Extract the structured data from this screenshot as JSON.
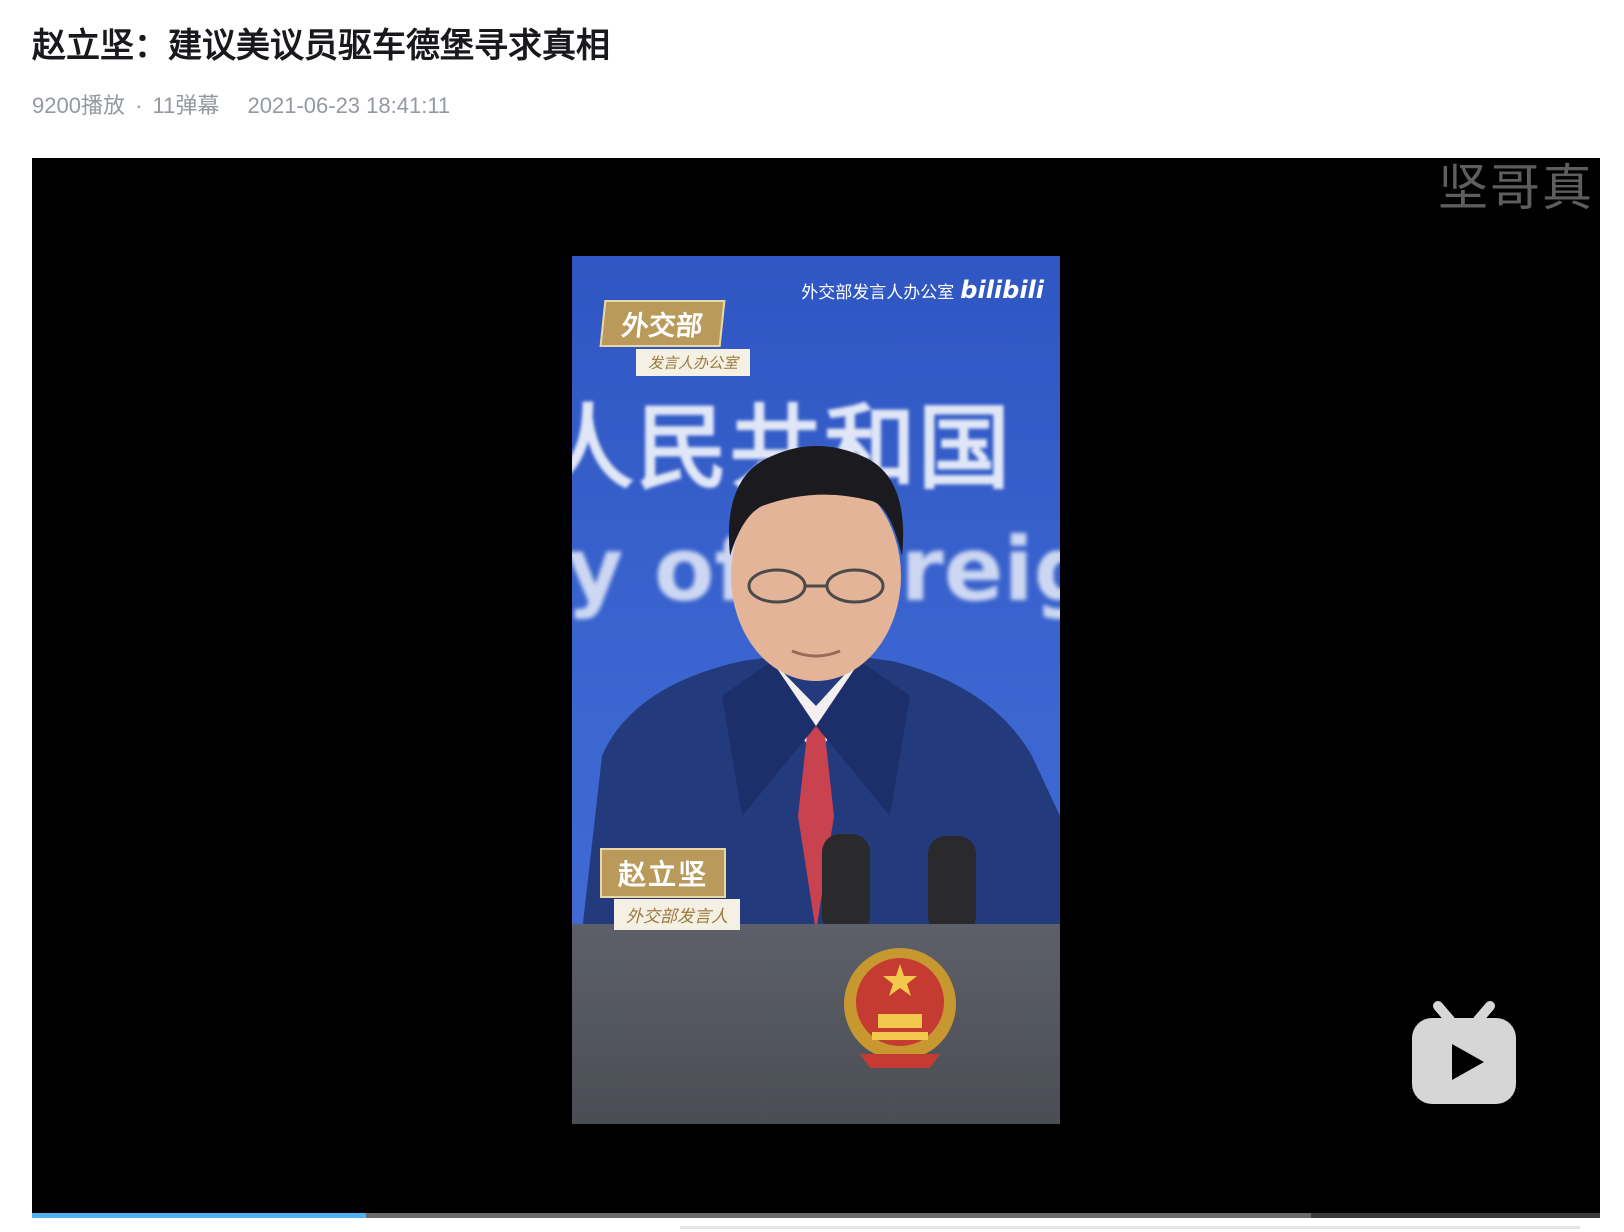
{
  "video": {
    "title": "赵立坚：建议美议员驱车德堡寻求真相",
    "views": "9200播放",
    "separator": "·",
    "danmaku": "11弹幕",
    "publish_time": "2021-06-23 18:41:11"
  },
  "player": {
    "watermark": "坚哥真",
    "progress_played": 0.213,
    "progress_buffered": 0.816,
    "icons": [
      "bilibili-tv-logo-icon"
    ]
  },
  "frame": {
    "brand_text": "外交部发言人办公室",
    "brand_logo": "bilibili",
    "badge_top_main": "外交部",
    "badge_top_sub": "发言人办公室",
    "background_text_line1": "人民共和国",
    "background_text_line2": "y of Foreign",
    "name_badge_main": "赵立坚",
    "name_badge_sub": "外交部发言人"
  },
  "colors": {
    "accent_progress": "#4fb2f0",
    "badge_gold": "#b99a5b",
    "backdrop_blue": "#3a64cf"
  }
}
